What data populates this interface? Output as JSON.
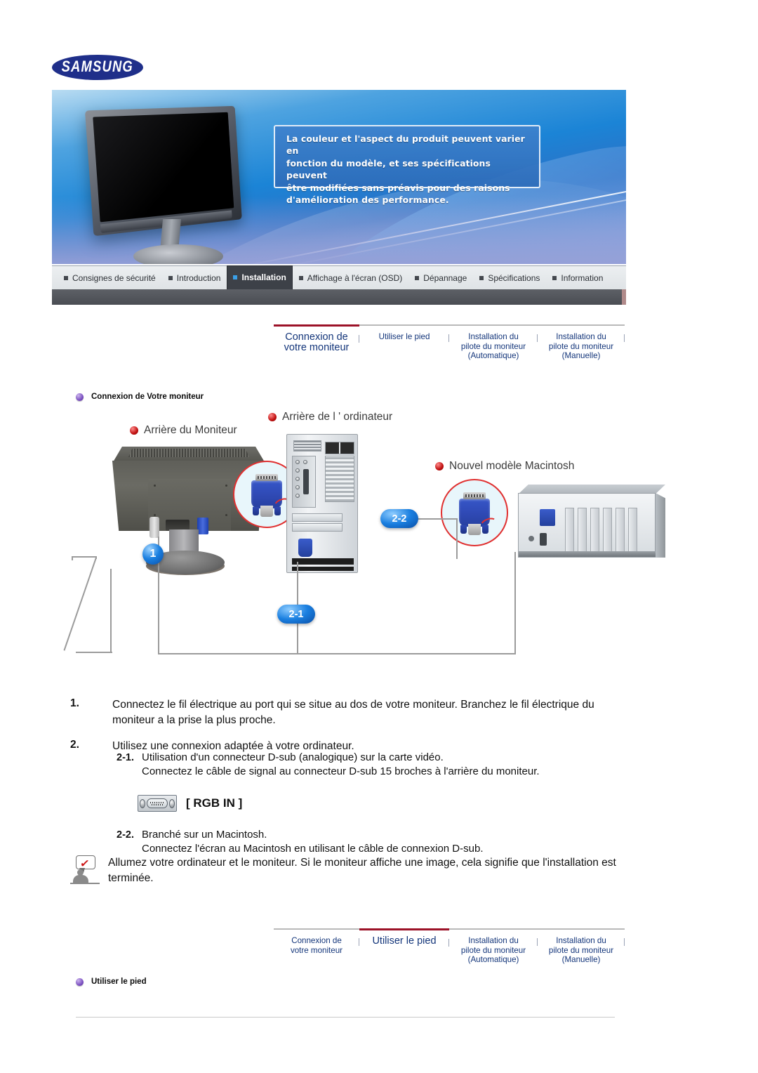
{
  "brand": {
    "logo_text": "SAMSUNG"
  },
  "banner": {
    "notice_line1": "La couleur et l'aspect du produit peuvent varier en",
    "notice_line2": "fonction du modèle, et ses spécifications peuvent",
    "notice_line3": "être modifiées sans préavis pour des raisons",
    "notice_line4": "d'amélioration des performance."
  },
  "nav": {
    "items": [
      {
        "label": "Consignes de sécurité",
        "active": false
      },
      {
        "label": "Introduction",
        "active": false
      },
      {
        "label": "Installation",
        "active": true
      },
      {
        "label": "Affichage à l'écran (OSD)",
        "active": false
      },
      {
        "label": "Dépannage",
        "active": false
      },
      {
        "label": "Spécifications",
        "active": false
      },
      {
        "label": "Information",
        "active": false
      }
    ]
  },
  "subtabs_top": [
    {
      "line1": "Connexion de",
      "line2": "votre moniteur",
      "line3": "",
      "active": true
    },
    {
      "line1": "Utiliser le pied",
      "line2": "",
      "line3": "",
      "active": false
    },
    {
      "line1": "Installation du",
      "line2": "pilote du moniteur",
      "line3": "(Automatique)",
      "active": false
    },
    {
      "line1": "Installation du",
      "line2": "pilote du moniteur",
      "line3": "(Manuelle)",
      "active": false
    }
  ],
  "subtabs_bottom": [
    {
      "line1": "Connexion de",
      "line2": "votre moniteur",
      "line3": "",
      "active": false
    },
    {
      "line1": "Utiliser le pied",
      "line2": "",
      "line3": "",
      "active": true
    },
    {
      "line1": "Installation du",
      "line2": "pilote du moniteur",
      "line3": "(Automatique)",
      "active": false
    },
    {
      "line1": "Installation du",
      "line2": "pilote du moniteur",
      "line3": "(Manuelle)",
      "active": false
    }
  ],
  "sections": {
    "heading_top": "Connexion de Votre moniteur",
    "heading_bottom": "Utiliser le pied"
  },
  "diagram": {
    "label_monitor": "Arrière du Moniteur",
    "label_pc": "Arrière de l ' ordinateur",
    "label_mac": "Nouvel modèle Macintosh",
    "badge_1": "1",
    "badge_2_1": "2-1",
    "badge_2_2": "2-2"
  },
  "steps": [
    {
      "num": "1.",
      "text": "Connectez le fil électrique au port qui se situe au dos de votre moniteur. Branchez le fil électrique du moniteur a la prise la plus proche."
    },
    {
      "num": "2.",
      "text": "Utilisez une connexion adaptée à votre ordinateur."
    }
  ],
  "substeps": {
    "s21_num": "2-1.",
    "s21_line1": "Utilisation d'un connecteur D-sub (analogique) sur la carte vidéo.",
    "s21_line2": "Connectez le câble de signal au connecteur D-sub 15 broches à l'arrière du moniteur.",
    "s22_num": "2-2.",
    "s22_line1": "Branché sur un Macintosh.",
    "s22_line2": "Connectez l'écran au Macintosh en utilisant le câble de connexion D-sub."
  },
  "rgb": {
    "label": "[ RGB IN ]"
  },
  "note": {
    "text": "Allumez votre ordinateur et le moniteur. Si le moniteur affiche une image, cela signifie que l'installation est terminée."
  },
  "colors": {
    "accent_red": "#9c1228",
    "nav_active_bg": "#3d4148",
    "tab_text": "#13357a",
    "badge_blue": "#1a7fe0"
  }
}
